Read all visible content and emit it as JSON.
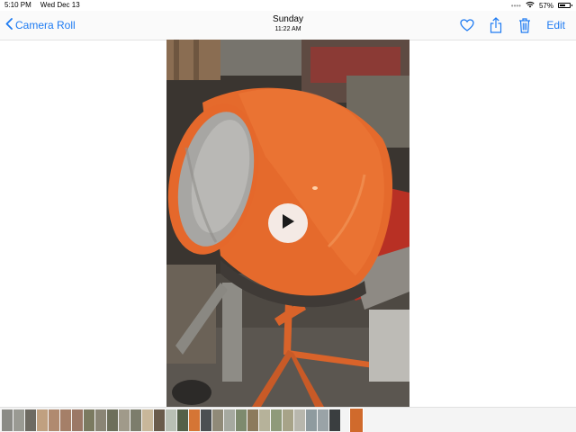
{
  "status_bar": {
    "time": "5:10 PM",
    "date": "Wed Dec 13",
    "battery_percent": "57%",
    "battery_level": 0.57,
    "wifi_icon": "wifi-icon",
    "signal_dots": "••••"
  },
  "nav": {
    "back_label": "Camera Roll",
    "title": "Sunday",
    "subtitle": "11:22 AM",
    "edit_label": "Edit",
    "icons": [
      "heart-icon",
      "share-icon",
      "trash-icon"
    ],
    "accent": "#1e7bf2"
  },
  "media": {
    "type": "video",
    "play_icon": "play-icon",
    "subject_colors": {
      "drum": "#e8692a",
      "drum_inner": "#a8a8a6",
      "background_dark": "#3a3530"
    }
  },
  "thumbnails": {
    "colors": [
      "#8b8b86",
      "#9a9a93",
      "#6e6a62",
      "#c0a080",
      "#b08a70",
      "#a57f68",
      "#9b7866",
      "#7b7a60",
      "#8a8575",
      "#6d6f5a",
      "#a09a8a",
      "#7c7d6c",
      "#c8b79a",
      "#6a5b4b",
      "#b9bfb4",
      "#556048",
      "#d57535",
      "#4b4f52",
      "#908a78",
      "#a6a9a0",
      "#7e8a6e",
      "#8c7a5d",
      "#b6b29a",
      "#8f9a7a",
      "#a7a388",
      "#b8b7ad",
      "#8f9b9f",
      "#9aa3a7",
      "#3a3e40",
      "#d06a2c"
    ],
    "current_index": 29
  }
}
